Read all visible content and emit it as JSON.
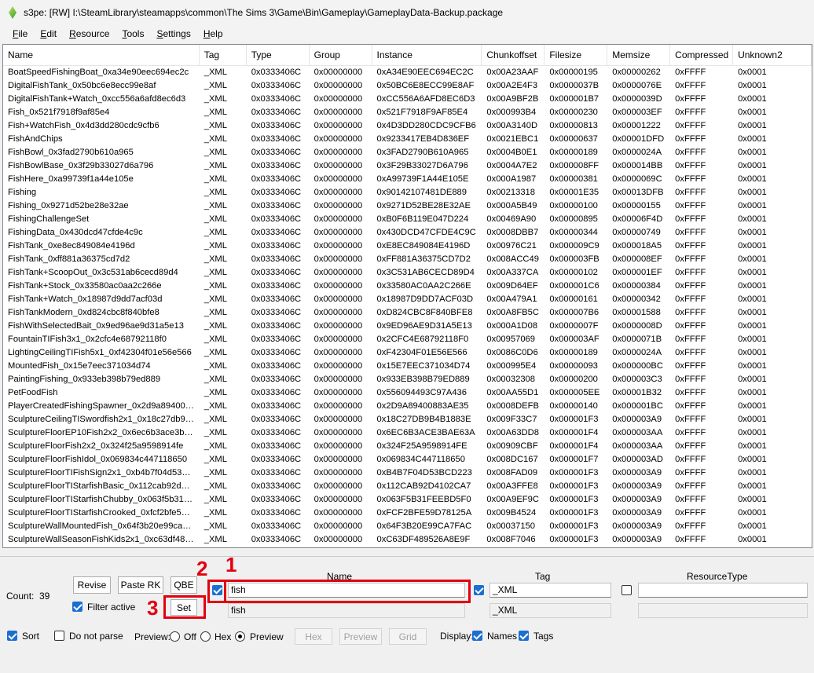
{
  "window": {
    "title": "s3pe: [RW] I:\\SteamLibrary\\steamapps\\common\\The Sims 3\\Game\\Bin\\Gameplay\\GameplayData-Backup.package"
  },
  "menu": [
    {
      "key": "F",
      "rest": "ile"
    },
    {
      "key": "E",
      "rest": "dit"
    },
    {
      "key": "R",
      "rest": "esource"
    },
    {
      "key": "T",
      "rest": "ools"
    },
    {
      "key": "S",
      "rest": "ettings"
    },
    {
      "key": "H",
      "rest": "elp"
    }
  ],
  "columns": [
    "Name",
    "Tag",
    "Type",
    "Group",
    "Instance",
    "Chunkoffset",
    "Filesize",
    "Memsize",
    "Compressed",
    "Unknown2"
  ],
  "rows": [
    [
      "BoatSpeedFishingBoat_0xa34e90eec694ec2c",
      "_XML",
      "0x0333406C",
      "0x00000000",
      "0xA34E90EEC694EC2C",
      "0x00A23AAF",
      "0x00000195",
      "0x00000262",
      "0xFFFF",
      "0x0001"
    ],
    [
      "DigitalFishTank_0x50bc6e8ecc99e8af",
      "_XML",
      "0x0333406C",
      "0x00000000",
      "0x50BC6E8ECC99E8AF",
      "0x00A2E4F3",
      "0x0000037B",
      "0x0000076E",
      "0xFFFF",
      "0x0001"
    ],
    [
      "DigitalFishTank+Watch_0xcc556a6afd8ec6d3",
      "_XML",
      "0x0333406C",
      "0x00000000",
      "0xCC556A6AFD8EC6D3",
      "0x00A9BF2B",
      "0x000001B7",
      "0x0000039D",
      "0xFFFF",
      "0x0001"
    ],
    [
      "Fish_0x521f7918f9af85e4",
      "_XML",
      "0x0333406C",
      "0x00000000",
      "0x521F7918F9AF85E4",
      "0x000993B4",
      "0x00000230",
      "0x000003EF",
      "0xFFFF",
      "0x0001"
    ],
    [
      "Fish+WatchFish_0x4d3dd280cdc9cfb6",
      "_XML",
      "0x0333406C",
      "0x00000000",
      "0x4D3DD280CDC9CFB6",
      "0x00A3140D",
      "0x00000813",
      "0x00001222",
      "0xFFFF",
      "0x0001"
    ],
    [
      "FishAndChips",
      "_XML",
      "0x0333406C",
      "0x00000000",
      "0x9233417EB4D836EF",
      "0x0021EBC1",
      "0x00000637",
      "0x00001DFD",
      "0xFFFF",
      "0x0001"
    ],
    [
      "FishBowl_0x3fad2790b610a965",
      "_XML",
      "0x0333406C",
      "0x00000000",
      "0x3FAD2790B610A965",
      "0x0004B0E1",
      "0x00000189",
      "0x0000024A",
      "0xFFFF",
      "0x0001"
    ],
    [
      "FishBowlBase_0x3f29b33027d6a796",
      "_XML",
      "0x0333406C",
      "0x00000000",
      "0x3F29B33027D6A796",
      "0x0004A7E2",
      "0x000008FF",
      "0x000014BB",
      "0xFFFF",
      "0x0001"
    ],
    [
      "FishHere_0xa99739f1a44e105e",
      "_XML",
      "0x0333406C",
      "0x00000000",
      "0xA99739F1A44E105E",
      "0x000A1987",
      "0x00000381",
      "0x0000069C",
      "0xFFFF",
      "0x0001"
    ],
    [
      "Fishing",
      "_XML",
      "0x0333406C",
      "0x00000000",
      "0x90142107481DE889",
      "0x00213318",
      "0x00001E35",
      "0x00013DFB",
      "0xFFFF",
      "0x0001"
    ],
    [
      "Fishing_0x9271d52be28e32ae",
      "_XML",
      "0x0333406C",
      "0x00000000",
      "0x9271D52BE28E32AE",
      "0x000A5B49",
      "0x00000100",
      "0x00000155",
      "0xFFFF",
      "0x0001"
    ],
    [
      "FishingChallengeSet",
      "_XML",
      "0x0333406C",
      "0x00000000",
      "0xB0F6B119E047D224",
      "0x00469A90",
      "0x00000895",
      "0x00006F4D",
      "0xFFFF",
      "0x0001"
    ],
    [
      "FishingData_0x430dcd47cfde4c9c",
      "_XML",
      "0x0333406C",
      "0x00000000",
      "0x430DCD47CFDE4C9C",
      "0x0008DBB7",
      "0x00000344",
      "0x00000749",
      "0xFFFF",
      "0x0001"
    ],
    [
      "FishTank_0xe8ec849084e4196d",
      "_XML",
      "0x0333406C",
      "0x00000000",
      "0xE8EC849084E4196D",
      "0x00976C21",
      "0x000009C9",
      "0x000018A5",
      "0xFFFF",
      "0x0001"
    ],
    [
      "FishTank_0xff881a36375cd7d2",
      "_XML",
      "0x0333406C",
      "0x00000000",
      "0xFF881A36375CD7D2",
      "0x008ACC49",
      "0x000003FB",
      "0x000008EF",
      "0xFFFF",
      "0x0001"
    ],
    [
      "FishTank+ScoopOut_0x3c531ab6cecd89d4",
      "_XML",
      "0x0333406C",
      "0x00000000",
      "0x3C531AB6CECD89D4",
      "0x00A337CA",
      "0x00000102",
      "0x000001EF",
      "0xFFFF",
      "0x0001"
    ],
    [
      "FishTank+Stock_0x33580ac0aa2c266e",
      "_XML",
      "0x0333406C",
      "0x00000000",
      "0x33580AC0AA2C266E",
      "0x009D64EF",
      "0x000001C6",
      "0x00000384",
      "0xFFFF",
      "0x0001"
    ],
    [
      "FishTank+Watch_0x18987d9dd7acf03d",
      "_XML",
      "0x0333406C",
      "0x00000000",
      "0x18987D9DD7ACF03D",
      "0x00A479A1",
      "0x00000161",
      "0x00000342",
      "0xFFFF",
      "0x0001"
    ],
    [
      "FishTankModern_0xd824cbc8f840bfe8",
      "_XML",
      "0x0333406C",
      "0x00000000",
      "0xD824CBC8F840BFE8",
      "0x00A8FB5C",
      "0x000007B6",
      "0x00001588",
      "0xFFFF",
      "0x0001"
    ],
    [
      "FishWithSelectedBait_0x9ed96ae9d31a5e13",
      "_XML",
      "0x0333406C",
      "0x00000000",
      "0x9ED96AE9D31A5E13",
      "0x000A1D08",
      "0x0000007F",
      "0x0000008D",
      "0xFFFF",
      "0x0001"
    ],
    [
      "FountainTIFish3x1_0x2cfc4e68792118f0",
      "_XML",
      "0x0333406C",
      "0x00000000",
      "0x2CFC4E68792118F0",
      "0x00957069",
      "0x000003AF",
      "0x0000071B",
      "0xFFFF",
      "0x0001"
    ],
    [
      "LightingCeilingTIFish5x1_0xf42304f01e56e566",
      "_XML",
      "0x0333406C",
      "0x00000000",
      "0xF42304F01E56E566",
      "0x0086C0D6",
      "0x00000189",
      "0x0000024A",
      "0xFFFF",
      "0x0001"
    ],
    [
      "MountedFish_0x15e7eec371034d74",
      "_XML",
      "0x0333406C",
      "0x00000000",
      "0x15E7EEC371034D74",
      "0x000995E4",
      "0x00000093",
      "0x000000BC",
      "0xFFFF",
      "0x0001"
    ],
    [
      "PaintingFishing_0x933eb398b79ed889",
      "_XML",
      "0x0333406C",
      "0x00000000",
      "0x933EB398B79ED889",
      "0x00032308",
      "0x00000200",
      "0x000003C3",
      "0xFFFF",
      "0x0001"
    ],
    [
      "PetFoodFish",
      "_XML",
      "0x0333406C",
      "0x00000000",
      "0x556094493C97A436",
      "0x00AA55D1",
      "0x000005EE",
      "0x00001B32",
      "0xFFFF",
      "0x0001"
    ],
    [
      "PlayerCreatedFishingSpawner_0x2d9a8940088...",
      "_XML",
      "0x0333406C",
      "0x00000000",
      "0x2D9A89400883AE35",
      "0x0008DEFB",
      "0x00000140",
      "0x000001BC",
      "0xFFFF",
      "0x0001"
    ],
    [
      "SculptureCeilingTISwordfish2x1_0x18c27db9b4...",
      "_XML",
      "0x0333406C",
      "0x00000000",
      "0x18C27DB9B4B1883E",
      "0x009F33C7",
      "0x000001F3",
      "0x000003A9",
      "0xFFFF",
      "0x0001"
    ],
    [
      "SculptureFloorEP10Fish2x2_0x6ec6b3ace3bae...",
      "_XML",
      "0x0333406C",
      "0x00000000",
      "0x6EC6B3ACE3BAE63A",
      "0x00A63DD8",
      "0x000001F4",
      "0x000003AA",
      "0xFFFF",
      "0x0001"
    ],
    [
      "SculptureFloorFish2x2_0x324f25a9598914fe",
      "_XML",
      "0x0333406C",
      "0x00000000",
      "0x324F25A9598914FE",
      "0x00909CBF",
      "0x000001F4",
      "0x000003AA",
      "0xFFFF",
      "0x0001"
    ],
    [
      "SculptureFloorFishIdol_0x069834c447118650",
      "_XML",
      "0x0333406C",
      "0x00000000",
      "0x069834C447118650",
      "0x008DC167",
      "0x000001F7",
      "0x000003AD",
      "0xFFFF",
      "0x0001"
    ],
    [
      "SculptureFloorTIFishSign2x1_0xb4b7f04d53bcd...",
      "_XML",
      "0x0333406C",
      "0x00000000",
      "0xB4B7F04D53BCD223",
      "0x008FAD09",
      "0x000001F3",
      "0x000003A9",
      "0xFFFF",
      "0x0001"
    ],
    [
      "SculptureFloorTIStarfishBasic_0x112cab92d410...",
      "_XML",
      "0x0333406C",
      "0x00000000",
      "0x112CAB92D4102CA7",
      "0x00A3FFE8",
      "0x000001F3",
      "0x000003A9",
      "0xFFFF",
      "0x0001"
    ],
    [
      "SculptureFloorTIStarfishChubby_0x063f5b31fee...",
      "_XML",
      "0x0333406C",
      "0x00000000",
      "0x063F5B31FEEBD5F0",
      "0x00A9EF9C",
      "0x000001F3",
      "0x000003A9",
      "0xFFFF",
      "0x0001"
    ],
    [
      "SculptureFloorTIStarfishCrooked_0xfcf2bfe59d7...",
      "_XML",
      "0x0333406C",
      "0x00000000",
      "0xFCF2BFE59D78125A",
      "0x009B4524",
      "0x000001F3",
      "0x000003A9",
      "0xFFFF",
      "0x0001"
    ],
    [
      "SculptureWallMountedFish_0x64f3b20e99ca7fac",
      "_XML",
      "0x0333406C",
      "0x00000000",
      "0x64F3B20E99CA7FAC",
      "0x00037150",
      "0x000001F3",
      "0x000003A9",
      "0xFFFF",
      "0x0001"
    ],
    [
      "SculptureWallSeasonFishKids2x1_0xc63df4895...",
      "_XML",
      "0x0333406C",
      "0x00000000",
      "0xC63DF489526A8E9F",
      "0x008F7046",
      "0x000001F3",
      "0x000003A9",
      "0xFFFF",
      "0x0001"
    ]
  ],
  "panel": {
    "count_label": "Count:",
    "count_value": "39",
    "revise_label": "Revise",
    "paste_rk_label": "Paste RK",
    "qbe_label": "QBE",
    "filter_active_label": "Filter active",
    "set_label": "Set",
    "name_header": "Name",
    "tag_header": "Tag",
    "resourcetype_header": "ResourceType",
    "name_filter_value": "fish",
    "name_current_value": "fish",
    "tag_filter_value": "_XML",
    "tag_current_value": "_XML",
    "resourcetype_filter_value": "",
    "sort_label": "Sort",
    "do_not_parse_label": "Do not parse",
    "preview_label": "Preview:",
    "off_label": "Off",
    "hex_radio_label": "Hex",
    "preview_radio_label": "Preview",
    "hex_btn_label": "Hex",
    "preview_btn_label": "Preview",
    "grid_btn_label": "Grid",
    "display_label": "Display:",
    "names_label": "Names",
    "tags_label": "Tags"
  },
  "annotations": {
    "one": "1",
    "two": "2",
    "three": "3",
    "color": "#e3000f"
  }
}
